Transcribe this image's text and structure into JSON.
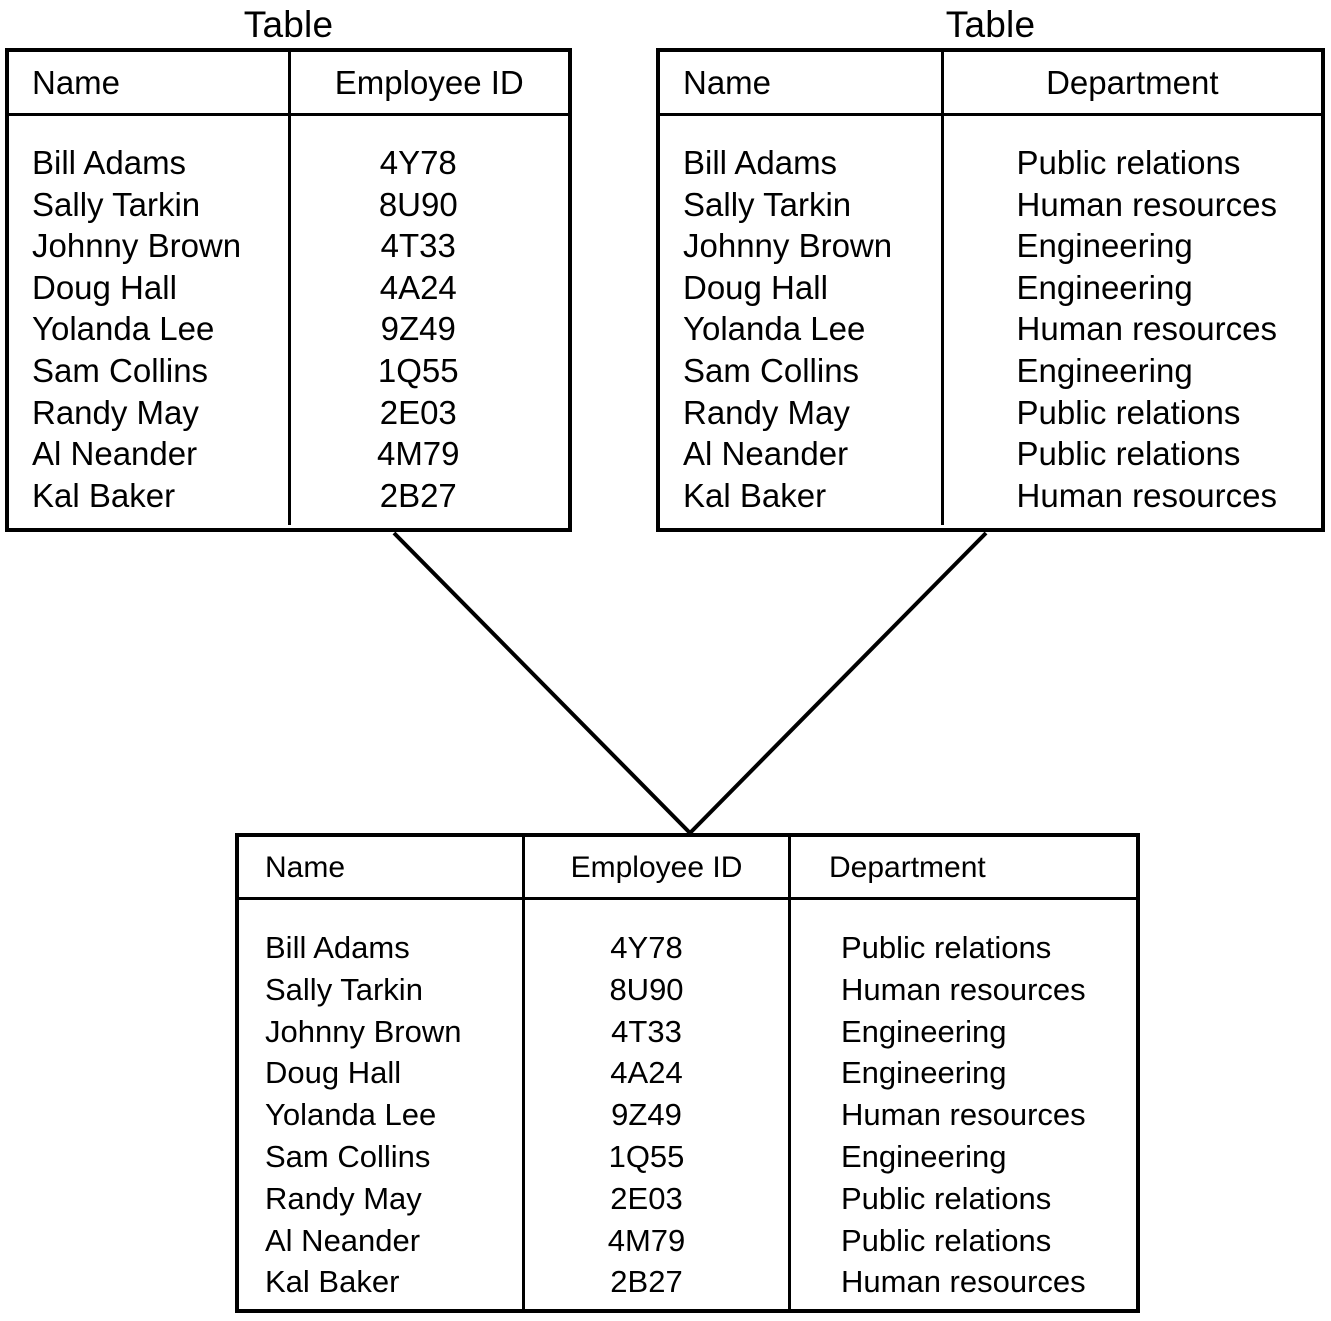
{
  "diagram": {
    "type": "database-join-diagram",
    "caption_label": "Table",
    "line_color": "#000000",
    "background_color": "#ffffff"
  },
  "source_table_left": {
    "caption": "Table",
    "columns": [
      "Name",
      "Employee ID"
    ],
    "names": [
      "Bill Adams",
      "Sally Tarkin",
      "Johnny Brown",
      "Doug Hall",
      "Yolanda Lee",
      "Sam Collins",
      "Randy May",
      "Al Neander",
      "Kal Baker"
    ],
    "employee_ids": [
      "4Y78",
      "8U90",
      "4T33",
      "4A24",
      "9Z49",
      "1Q55",
      "2E03",
      "4M79",
      "2B27"
    ]
  },
  "source_table_right": {
    "caption": "Table",
    "columns": [
      "Name",
      "Department"
    ],
    "names": [
      "Bill Adams",
      "Sally Tarkin",
      "Johnny Brown",
      "Doug Hall",
      "Yolanda Lee",
      "Sam Collins",
      "Randy May",
      "Al Neander",
      "Kal Baker"
    ],
    "departments": [
      "Public relations",
      "Human resources",
      "Engineering",
      "Engineering",
      "Human resources",
      "Engineering",
      "Public relations",
      "Public relations",
      "Human resources"
    ]
  },
  "joined_table": {
    "columns": [
      "Name",
      "Employee ID",
      "Department"
    ],
    "rows": [
      [
        "Bill Adams",
        "4Y78",
        "Public relations"
      ],
      [
        "Sally Tarkin",
        "8U90",
        "Human resources"
      ],
      [
        "Johnny Brown",
        "4T33",
        "Engineering"
      ],
      [
        "Doug Hall",
        "4A24",
        "Engineering"
      ],
      [
        "Yolanda Lee",
        "9Z49",
        "Human resources"
      ],
      [
        "Sam Collins",
        "1Q55",
        "Engineering"
      ],
      [
        "Randy May",
        "2E03",
        "Public relations"
      ],
      [
        "Al Neander",
        "4M79",
        "Public relations"
      ],
      [
        "Kal Baker",
        "2B27",
        "Human resources"
      ]
    ]
  }
}
